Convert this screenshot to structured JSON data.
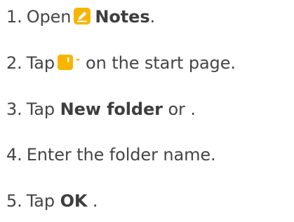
{
  "steps": [
    {
      "number": "1.",
      "before": "Open",
      "icon": "notes-app-icon",
      "bold": "Notes",
      "after": "."
    },
    {
      "number": "2.",
      "before": "Tap",
      "icon": "new-folder-dropdown-icon",
      "after": "on the start page."
    },
    {
      "number": "3.",
      "before": "Tap",
      "bold": "New folder",
      "after": "or ."
    },
    {
      "number": "4.",
      "text": "Enter the folder name."
    },
    {
      "number": "5.",
      "before": "Tap",
      "bold": "OK",
      "after": "."
    }
  ],
  "colors": {
    "text": "#454545",
    "icon_yellow": "#F7B500"
  }
}
